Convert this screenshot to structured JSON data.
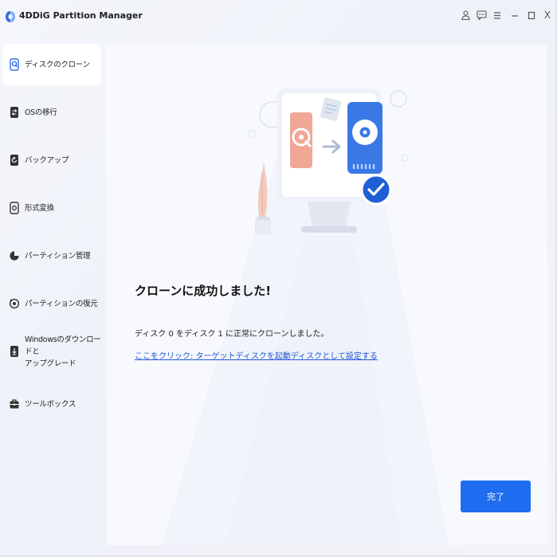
{
  "app": {
    "title": "4DDiG Partition Manager"
  },
  "window_controls": [
    {
      "name": "account-icon"
    },
    {
      "name": "feedback-icon"
    },
    {
      "name": "menu-icon"
    },
    {
      "name": "minimize-icon"
    },
    {
      "name": "maximize-icon"
    },
    {
      "name": "close-icon",
      "glyph": "X"
    }
  ],
  "sidebar": {
    "items": [
      {
        "label": "ディスクのクローン",
        "icon": "disk-clone-icon",
        "active": true
      },
      {
        "label": "OSの移行",
        "icon": "os-migration-icon",
        "active": false
      },
      {
        "label": "バックアップ",
        "icon": "backup-icon",
        "active": false
      },
      {
        "label": "形式変換",
        "icon": "format-convert-icon",
        "active": false
      },
      {
        "label": "パーティション管理",
        "icon": "partition-manage-icon",
        "active": false
      },
      {
        "label": "パーティションの復元",
        "icon": "partition-recovery-icon",
        "active": false
      },
      {
        "label": "Windowsのダウンロードと",
        "label_line2": "アップグレード",
        "icon": "windows-download-icon",
        "active": false
      },
      {
        "label": "ツールボックス",
        "icon": "toolbox-icon",
        "active": false
      }
    ]
  },
  "main": {
    "heading": "クローンに成功しました!",
    "description": "ディスク 0 をディスク 1 に正常にクローンしました。",
    "link": "ここをクリック: ターゲットディスクを起動ディスクとして設定する",
    "done_button": "完了"
  },
  "colors": {
    "accent": "#1f6cf0",
    "link": "#2257d8",
    "source_disk": "#f0a796",
    "target_disk": "#3a78e6",
    "check_badge": "#1f5fd6"
  }
}
